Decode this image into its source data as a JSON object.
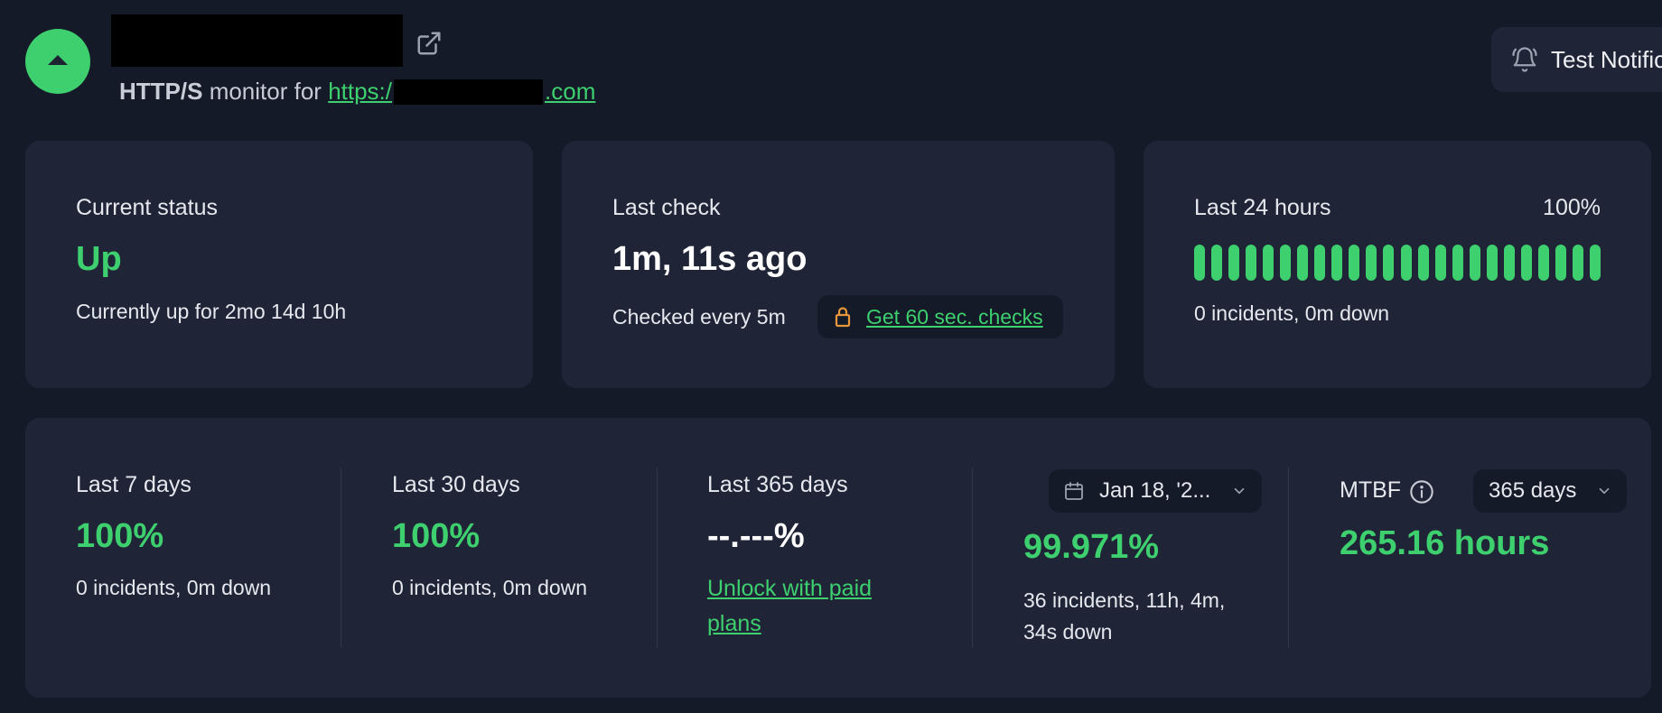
{
  "header": {
    "monitor_type": "HTTP/S",
    "monitor_for_text": "monitor for",
    "url_prefix": "https:/",
    "url_suffix": ".com",
    "test_notification_label": "Test Notific"
  },
  "current_status": {
    "label": "Current status",
    "value": "Up",
    "detail": "Currently up for 2mo 14d 10h"
  },
  "last_check": {
    "label": "Last check",
    "value": "1m, 11s ago",
    "interval": "Checked every 5m",
    "upsell_link": "Get 60 sec. checks"
  },
  "last_24h": {
    "label": "Last 24 hours",
    "percent": "100%",
    "detail": "0 incidents, 0m down",
    "bar_count": 24,
    "bar_status": "up"
  },
  "periods": [
    {
      "label": "Last 7 days",
      "value": "100%",
      "detail": "0 incidents, 0m down"
    },
    {
      "label": "Last 30 days",
      "value": "100%",
      "detail": "0 incidents, 0m down"
    },
    {
      "label": "Last 365 days",
      "value": "--.---%",
      "unlock_link": "Unlock with paid plans"
    }
  ],
  "custom_range": {
    "date_select": "Jan 18, '2...",
    "value": "99.971%",
    "detail": "36 incidents, 11h, 4m, 34s down"
  },
  "mtbf": {
    "label": "MTBF",
    "range_select": "365 days",
    "value": "265.16 hours"
  },
  "colors": {
    "background": "#141a28",
    "card": "#1f2537",
    "accent_green": "#3ecf6e",
    "lock_orange": "#e8963a"
  },
  "icons": {
    "status": "arrow-up-icon",
    "external_link": "external-link-icon",
    "bell": "bell-icon",
    "lock": "lock-icon",
    "calendar": "calendar-icon",
    "info": "info-icon",
    "chevron": "chevron-down-icon"
  }
}
